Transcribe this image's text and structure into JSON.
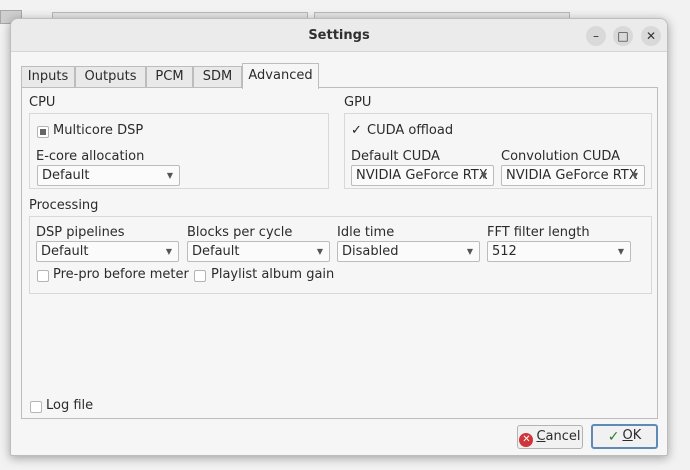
{
  "window": {
    "title": "Settings"
  },
  "tabs": [
    {
      "label": "Inputs"
    },
    {
      "label": "Outputs"
    },
    {
      "label": "PCM"
    },
    {
      "label": "SDM"
    },
    {
      "label": "Advanced"
    }
  ],
  "cpu": {
    "group_label": "CPU",
    "multicore_label": "Multicore DSP",
    "ecore_label": "E-core allocation",
    "ecore_value": "Default"
  },
  "gpu": {
    "group_label": "GPU",
    "cuda_offload_label": "CUDA offload",
    "default_cuda_label": "Default CUDA",
    "default_cuda_value": "NVIDIA GeForce RTX",
    "convolution_cuda_label": "Convolution CUDA",
    "convolution_cuda_value": "NVIDIA GeForce RTX"
  },
  "processing": {
    "group_label": "Processing",
    "dsp_pipelines_label": "DSP pipelines",
    "dsp_pipelines_value": "Default",
    "blocks_label": "Blocks per cycle",
    "blocks_value": "Default",
    "idle_label": "Idle time",
    "idle_value": "Disabled",
    "fft_label": "FFT filter length",
    "fft_value": "512",
    "prepro_label": "Pre-pro before meter",
    "playlist_gain_label": "Playlist album gain"
  },
  "log_file_label": "Log file",
  "buttons": {
    "cancel_prefix": "C",
    "cancel_rest": "ancel",
    "ok_prefix": "O",
    "ok_rest": "K"
  }
}
